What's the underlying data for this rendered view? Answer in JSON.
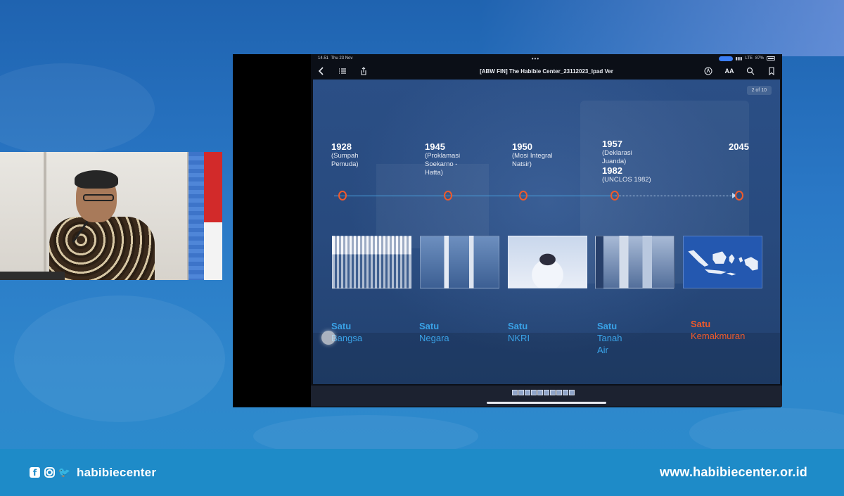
{
  "status_bar": {
    "time": "14.51",
    "date": "Thu 23 Nov",
    "network": "LTE",
    "battery": "87%"
  },
  "document": {
    "title": "[ABW FIN] The Habibie Center_23112023_Ipad Ver",
    "page_indicator": "2 of 10"
  },
  "toolbar": {
    "icons": [
      "back-icon",
      "list-icon",
      "share-icon",
      "markup-icon",
      "text-size-icon",
      "search-icon",
      "bookmark-icon"
    ],
    "text_size_glyph": "AA"
  },
  "timeline": [
    {
      "year": "1928",
      "desc": [
        "(Sumpah",
        "Pemuda)"
      ]
    },
    {
      "year": "1945",
      "desc": [
        "(Proklamasi",
        "Soekarno -",
        "Hatta)"
      ]
    },
    {
      "year": "1950",
      "desc": [
        "(Mosi Integral",
        "Natsir)"
      ]
    },
    {
      "year": "1957",
      "desc": [
        "(Deklarasi",
        "Juanda)"
      ],
      "year2": "1982",
      "desc2": "(UNCLOS 1982)"
    },
    {
      "year": "2045",
      "desc": []
    }
  ],
  "themes": [
    {
      "satu": "Satu",
      "words": [
        "Bangsa"
      ]
    },
    {
      "satu": "Satu",
      "words": [
        "Negara"
      ]
    },
    {
      "satu": "Satu",
      "words": [
        "NKRI"
      ]
    },
    {
      "satu": "Satu",
      "words": [
        "Tanah",
        "Air"
      ]
    },
    {
      "satu": "Satu",
      "words": [
        "Kemakmuran"
      ]
    }
  ],
  "brand": {
    "handle": "habibiecenter",
    "website": "www.habibiecenter.or.id"
  },
  "colors": {
    "accent_orange": "#f05a2a",
    "accent_blue": "#3aa3e8",
    "brand_bar": "#1e8bc8"
  }
}
